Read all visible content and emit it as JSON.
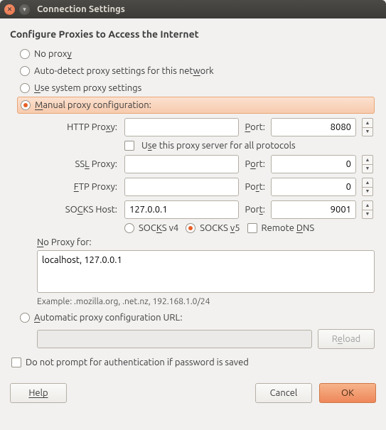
{
  "window": {
    "title": "Connection Settings"
  },
  "heading": "Configure Proxies to Access the Internet",
  "proxy_mode": {
    "no_proxy_pre": "No prox",
    "no_proxy_accel": "y",
    "auto_detect_pre": "Auto-detect proxy settings for this net",
    "auto_detect_accel": "w",
    "auto_detect_post": "ork",
    "system_pre": "",
    "system_accel": "U",
    "system_post": "se system proxy settings",
    "manual_pre": "",
    "manual_accel": "M",
    "manual_post": "anual proxy configuration:"
  },
  "rows": {
    "http_label_pre": "HTTP Pro",
    "http_label_accel": "x",
    "http_label_post": "y:",
    "http_host": "",
    "http_port_label_accel": "P",
    "http_port_label_post": "ort:",
    "http_port": "8080",
    "use_all_pre": "U",
    "use_all_accel": "s",
    "use_all_post": "e this proxy server for all protocols",
    "ssl_label_pre": "SS",
    "ssl_label_accel": "L",
    "ssl_label_post": " Proxy:",
    "ssl_host": "",
    "ssl_port_label_pre": "P",
    "ssl_port_label_accel": "o",
    "ssl_port_label_post": "rt:",
    "ssl_port": "0",
    "ftp_label_accel": "F",
    "ftp_label_post": "TP Proxy:",
    "ftp_host": "",
    "ftp_port_label_pre": "Po",
    "ftp_port_label_accel": "r",
    "ftp_port_label_post": "t:",
    "ftp_port": "0",
    "socks_host_label_pre": "SO",
    "socks_host_label_accel": "C",
    "socks_host_label_post": "KS Host:",
    "socks_host": "127.0.0.1",
    "socks_port_label_pre": "Por",
    "socks_port_label_accel": "t",
    "socks_port_label_post": ":",
    "socks_port": "9001",
    "socks_v4_pre": "SOC",
    "socks_v4_accel": "K",
    "socks_v4_post": "S v4",
    "socks_v5_pre": "SOCKS ",
    "socks_v5_accel": "v",
    "socks_v5_post": "5",
    "remote_dns_pre": "Remote ",
    "remote_dns_accel": "D",
    "remote_dns_post": "NS"
  },
  "noproxy": {
    "label_accel": "N",
    "label_post": "o Proxy for:",
    "value": "localhost, 127.0.0.1",
    "example": "Example: .mozilla.org, .net.nz, 192.168.1.0/24"
  },
  "auto_url": {
    "radio_accel": "A",
    "radio_post": "utomatic proxy configuration URL:",
    "value": "",
    "reload_pre": "R",
    "reload_accel": "e",
    "reload_post": "load"
  },
  "no_prompt": {
    "pre": "Do not prompt for authentication if password is ",
    "accel": "i",
    "post": " saved",
    "full": "Do not prompt for authentication if password is saved"
  },
  "buttons": {
    "help": "Help",
    "cancel": "Cancel",
    "ok": "OK"
  }
}
